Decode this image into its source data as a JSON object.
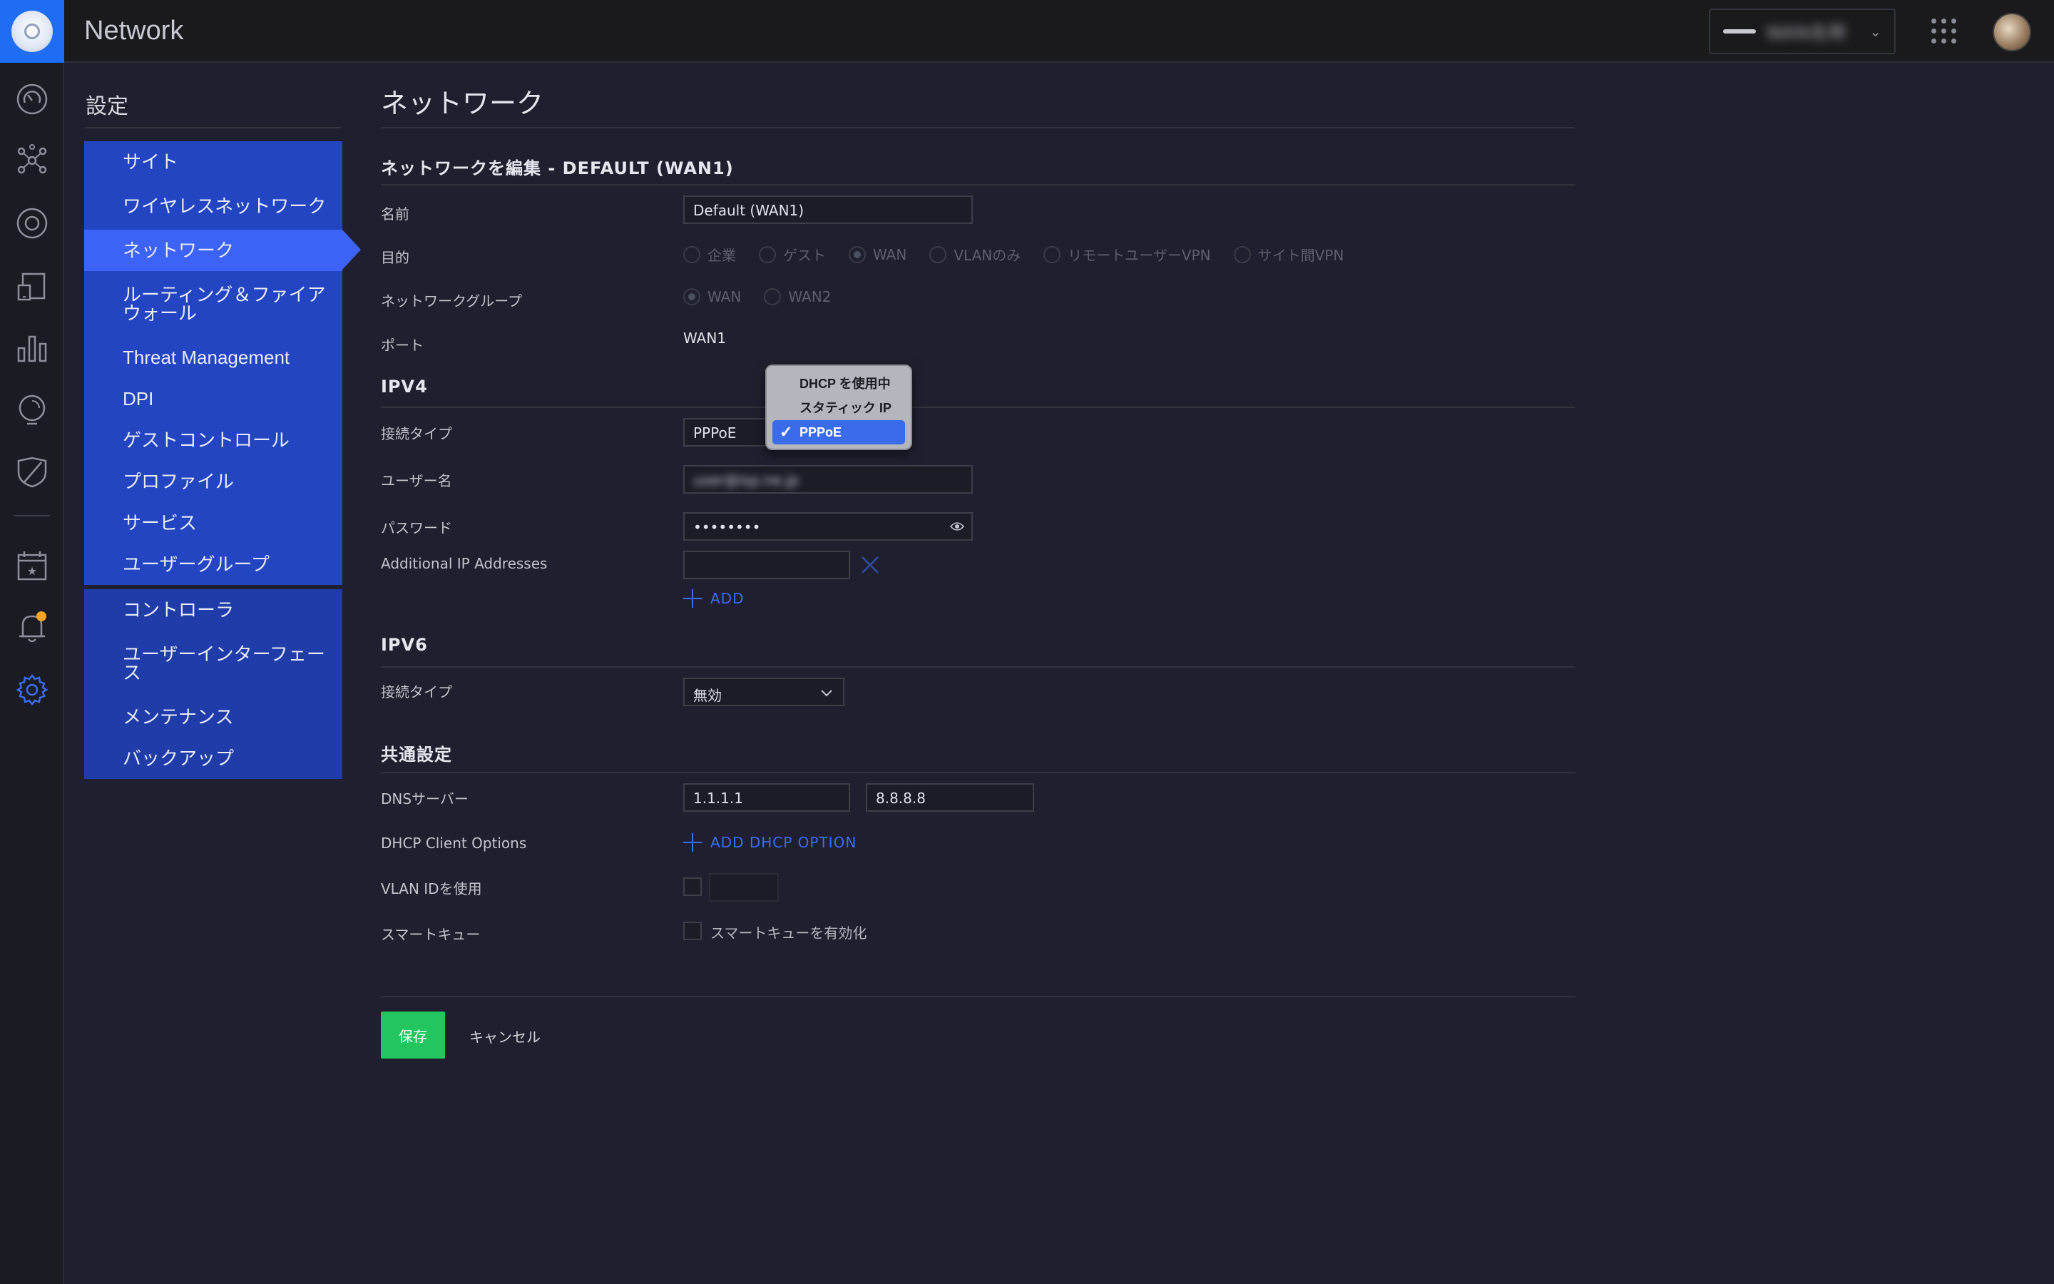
{
  "app": {
    "title": "Network"
  },
  "header": {
    "site_name": "WAN名称"
  },
  "settings": {
    "title": "設定",
    "menu_group1": [
      {
        "label": "サイト"
      },
      {
        "label": "ワイヤレスネットワーク"
      },
      {
        "label": "ネットワーク"
      },
      {
        "label": "ルーティング＆ファイアウォール"
      },
      {
        "label": "Threat Management"
      },
      {
        "label": "DPI"
      },
      {
        "label": "ゲストコントロール"
      },
      {
        "label": "プロファイル"
      },
      {
        "label": "サービス"
      },
      {
        "label": "ユーザーグループ"
      }
    ],
    "menu_group2": [
      {
        "label": "コントローラ"
      },
      {
        "label": "ユーザーインターフェース"
      },
      {
        "label": "メンテナンス"
      },
      {
        "label": "バックアップ"
      }
    ]
  },
  "page": {
    "title": "ネットワーク",
    "edit_title": "ネットワークを編集 - DEFAULT (WAN1)",
    "name_label": "名前",
    "name_value": "Default (WAN1)",
    "purpose_label": "目的",
    "purpose_options": [
      "企業",
      "ゲスト",
      "WAN",
      "VLANのみ",
      "リモートユーザーVPN",
      "サイト間VPN"
    ],
    "group_label": "ネットワークグループ",
    "group_options": [
      "WAN",
      "WAN2"
    ],
    "port_label": "ポート",
    "port_value": "WAN1"
  },
  "ipv4": {
    "title": "IPV4",
    "conn_type_label": "接続タイプ",
    "conn_type_value": "PPPoE",
    "username_label": "ユーザー名",
    "username_value": "user@isp.ne.jp",
    "password_label": "パスワード",
    "password_value": "••••••••",
    "additional_ip_label": "Additional IP Addresses",
    "add_label": "ADD",
    "dropdown_options": [
      "DHCP を使用中",
      "スタティック IP",
      "PPPoE"
    ]
  },
  "ipv6": {
    "title": "IPV6",
    "conn_type_label": "接続タイプ",
    "conn_type_value": "無効"
  },
  "common": {
    "title": "共通設定",
    "dns_label": "DNSサーバー",
    "dns1": "1.1.1.1",
    "dns2": "8.8.8.8",
    "dhcp_options_label": "DHCP Client Options",
    "add_dhcp_label": "ADD DHCP OPTION",
    "vlan_label": "VLAN IDを使用",
    "smartq_label": "スマートキュー",
    "smartq_check_label": "スマートキューを有効化"
  },
  "footer": {
    "save_label": "保存",
    "cancel_label": "キャンセル"
  },
  "colors": {
    "accent": "#3c63f6",
    "menu": "#2445c2",
    "save": "#22c55e",
    "bg": "#1f1f2f"
  }
}
